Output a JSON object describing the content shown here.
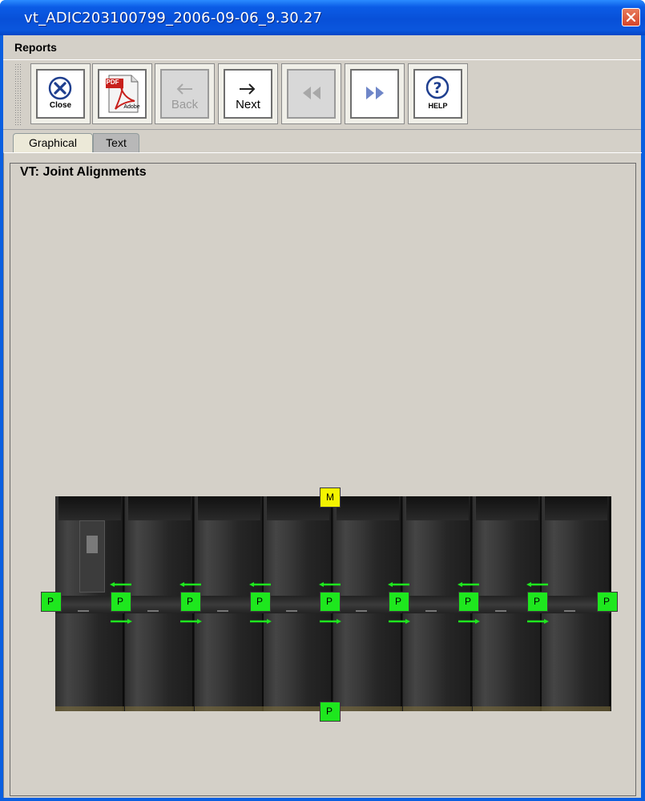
{
  "window": {
    "title": "vt_ADIC203100799_2006-09-06_9.30.27",
    "close_icon": "close-icon"
  },
  "menu": {
    "reports": "Reports"
  },
  "toolbar": {
    "close_label": "Close",
    "pdf_label": "Adobe",
    "pdf_badge": "PDF",
    "back_label": "Back",
    "next_label": "Next",
    "help_label": "HELP"
  },
  "tabs": {
    "graphical": "Graphical",
    "text": "Text"
  },
  "report": {
    "group_title": "VT: Joint Alignments",
    "top_marker": "M",
    "bottom_marker": "P",
    "side_markers": [
      "P",
      "P",
      "P",
      "P",
      "P",
      "P",
      "P",
      "P",
      "P"
    ]
  },
  "colors": {
    "pass": "#1ee71e",
    "motion": "#f4f400",
    "arrow": "#1ee71e"
  }
}
